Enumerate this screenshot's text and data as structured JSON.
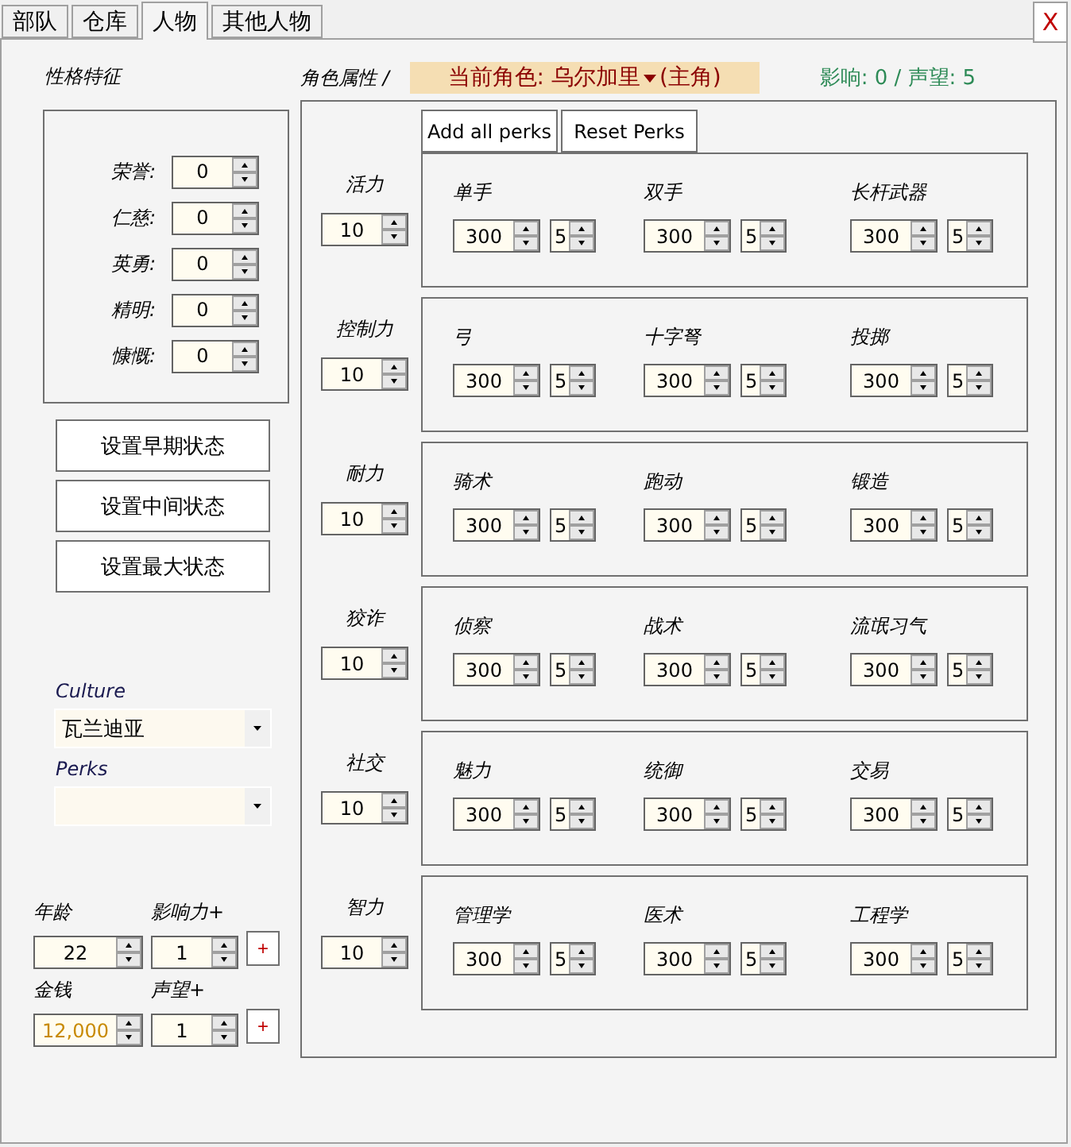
{
  "tabs": [
    {
      "label": "部队",
      "selected": false
    },
    {
      "label": "仓库",
      "selected": false
    },
    {
      "label": "人物",
      "selected": true
    },
    {
      "label": "其他人物",
      "selected": false
    }
  ],
  "close_button": "X",
  "traits": {
    "title": "性格特征",
    "items": [
      {
        "label": "荣誉:",
        "value": "0"
      },
      {
        "label": "仁慈:",
        "value": "0"
      },
      {
        "label": "英勇:",
        "value": "0"
      },
      {
        "label": "精明:",
        "value": "0"
      },
      {
        "label": "慷慨:",
        "value": "0"
      }
    ]
  },
  "state_buttons": [
    "设置早期状态",
    "设置中间状态",
    "设置最大状态"
  ],
  "culture": {
    "label": "Culture",
    "value": "瓦兰迪亚"
  },
  "perks": {
    "label": "Perks"
  },
  "stats": [
    {
      "label": "年龄",
      "value": "22",
      "color": "#000000"
    },
    {
      "label": "影响力+",
      "value": "1",
      "color": "#000000",
      "plus": "+"
    },
    {
      "label": "金钱",
      "value": "12,000",
      "color": "#c88a00"
    },
    {
      "label": "声望+",
      "value": "1",
      "color": "#000000",
      "plus": "+"
    }
  ],
  "attributes_title": "角色属性 /",
  "current_character": {
    "label": "当前角色: 乌尔加里",
    "role": "(主角)"
  },
  "summary": "影响: 0 / 声望: 5",
  "perk_buttons": [
    "Add all perks",
    "Reset Perks"
  ],
  "attributes": [
    {
      "name": "活力",
      "value": "10",
      "skills": [
        {
          "name": "单手",
          "value": "300",
          "focus": "5"
        },
        {
          "name": "双手",
          "value": "300",
          "focus": "5"
        },
        {
          "name": "长杆武器",
          "value": "300",
          "focus": "5"
        }
      ]
    },
    {
      "name": "控制力",
      "value": "10",
      "skills": [
        {
          "name": "弓",
          "value": "300",
          "focus": "5"
        },
        {
          "name": "十字弩",
          "value": "300",
          "focus": "5"
        },
        {
          "name": "投掷",
          "value": "300",
          "focus": "5"
        }
      ]
    },
    {
      "name": "耐力",
      "value": "10",
      "skills": [
        {
          "name": "骑术",
          "value": "300",
          "focus": "5"
        },
        {
          "name": "跑动",
          "value": "300",
          "focus": "5"
        },
        {
          "name": "锻造",
          "value": "300",
          "focus": "5"
        }
      ]
    },
    {
      "name": "狡诈",
      "value": "10",
      "skills": [
        {
          "name": "侦察",
          "value": "300",
          "focus": "5"
        },
        {
          "name": "战术",
          "value": "300",
          "focus": "5"
        },
        {
          "name": "流氓习气",
          "value": "300",
          "focus": "5"
        }
      ]
    },
    {
      "name": "社交",
      "value": "10",
      "skills": [
        {
          "name": "魅力",
          "value": "300",
          "focus": "5"
        },
        {
          "name": "统御",
          "value": "300",
          "focus": "5"
        },
        {
          "name": "交易",
          "value": "300",
          "focus": "5"
        }
      ]
    },
    {
      "name": "智力",
      "value": "10",
      "skills": [
        {
          "name": "管理学",
          "value": "300",
          "focus": "5"
        },
        {
          "name": "医术",
          "value": "300",
          "focus": "5"
        },
        {
          "name": "工程学",
          "value": "300",
          "focus": "5"
        }
      ]
    }
  ]
}
